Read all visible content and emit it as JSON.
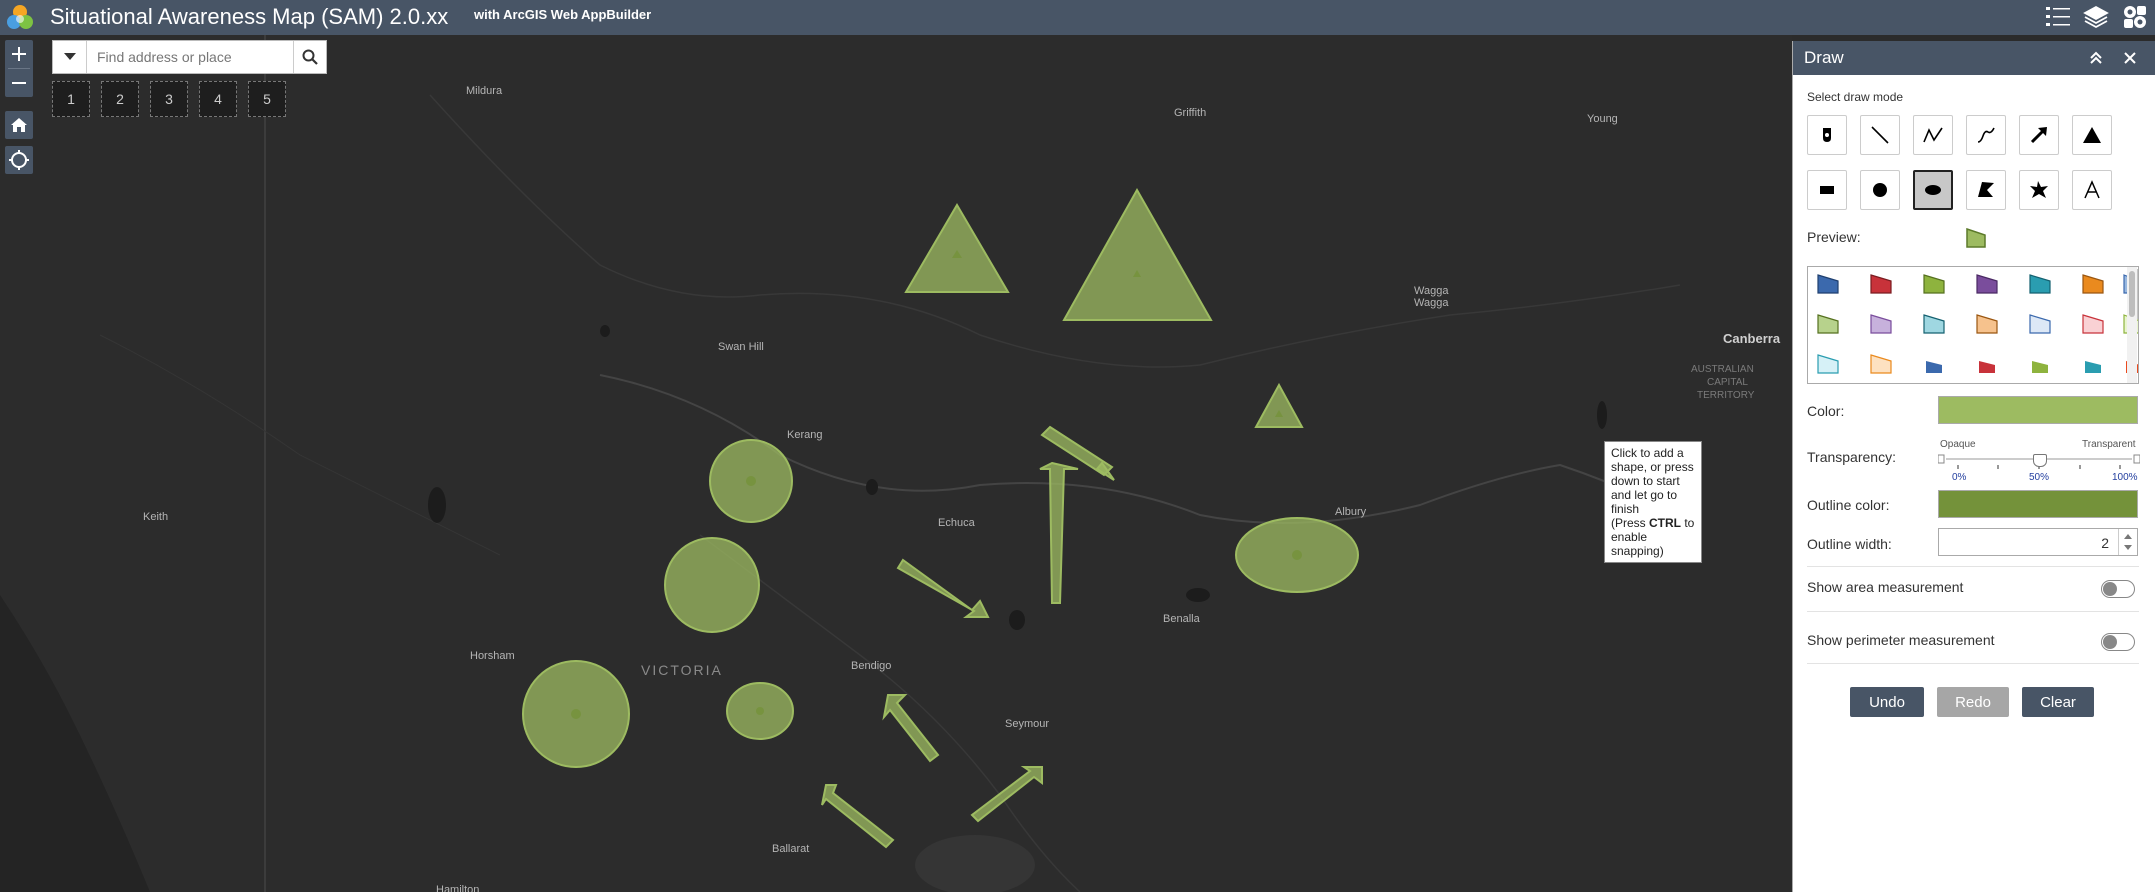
{
  "header": {
    "title": "Situational Awareness Map (SAM) 2.0.xx",
    "subtitle": "with ArcGIS Web AppBuilder"
  },
  "search": {
    "placeholder": "Find address or place"
  },
  "bookmarks": [
    "1",
    "2",
    "3",
    "4",
    "5"
  ],
  "map": {
    "labels": {
      "mildura": "Mildura",
      "griffith": "Griffith",
      "young": "Young",
      "wagga1": "Wagga",
      "wagga2": "Wagga",
      "canberra": "Canberra",
      "act1": "AUSTRALIAN",
      "act2": "CAPITAL",
      "act3": "TERRITORY",
      "swanhill": "Swan Hill",
      "kerang": "Kerang",
      "keith": "Keith",
      "echuca": "Echuca",
      "albury": "Albury",
      "benalla": "Benalla",
      "horsham": "Horsham",
      "victoria": "VICTORIA",
      "bendigo": "Bendigo",
      "seymour": "Seymour",
      "ballarat": "Ballarat",
      "hamilton": "Hamilton"
    },
    "shape_fill": "#9dbb61",
    "tooltip": {
      "line1": "Click to add a shape, or press down to start and let go to finish",
      "line2a": "(Press ",
      "line2b": "CTRL",
      "line2c": " to enable snapping)"
    }
  },
  "panel": {
    "title": "Draw",
    "select_mode_label": "Select draw mode",
    "modes": [
      "point-icon",
      "line-icon",
      "polyline-icon",
      "freehand-line-icon",
      "arrow-icon",
      "triangle-icon",
      "rectangle-icon",
      "circle-icon",
      "ellipse-icon",
      "polygon-icon",
      "freehand-polygon-icon",
      "text-icon"
    ],
    "active_mode": "ellipse-icon",
    "preview_label": "Preview:",
    "color_label": "Color:",
    "color_value": "#9dbb61",
    "transparency_label": "Transparency:",
    "opaque_label": "Opaque",
    "transparent_label": "Transparent",
    "ticks": [
      "0%",
      "50%",
      "100%"
    ],
    "transparency_value": 50,
    "outline_color_label": "Outline color:",
    "outline_color_value": "#74923a",
    "outline_width_label": "Outline width:",
    "outline_width_value": "2",
    "show_area_label": "Show area measurement",
    "show_perimeter_label": "Show perimeter measurement",
    "undo_label": "Undo",
    "redo_label": "Redo",
    "clear_label": "Clear"
  }
}
